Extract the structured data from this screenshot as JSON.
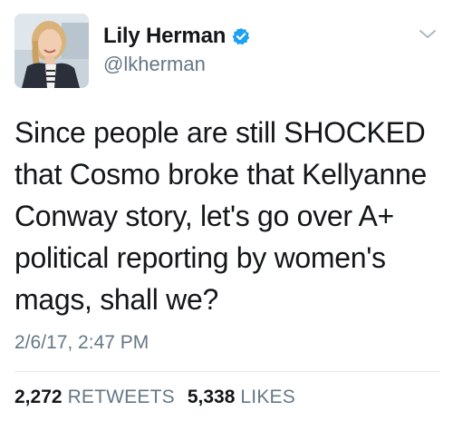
{
  "author": {
    "display_name": "Lily Herman",
    "handle": "@lkherman",
    "verified": true,
    "avatar_icon": "profile-photo"
  },
  "tweet": {
    "text": "Since people are still SHOCKED\nthat Cosmo broke that Kellyanne\nConway story, let's go over A+\npolitical reporting by women's\nmags, shall we?",
    "timestamp": "2/6/17, 2:47 PM"
  },
  "stats": {
    "retweets_count": "2,272",
    "retweets_label": "RETWEETS",
    "likes_count": "5,338",
    "likes_label": "LIKES"
  },
  "colors": {
    "text": "#14171a",
    "secondary": "#657786",
    "verified": "#1da1f2",
    "divider": "#e1e8ed"
  },
  "icons": {
    "verified": "verified-badge-icon",
    "more": "chevron-down-icon"
  }
}
